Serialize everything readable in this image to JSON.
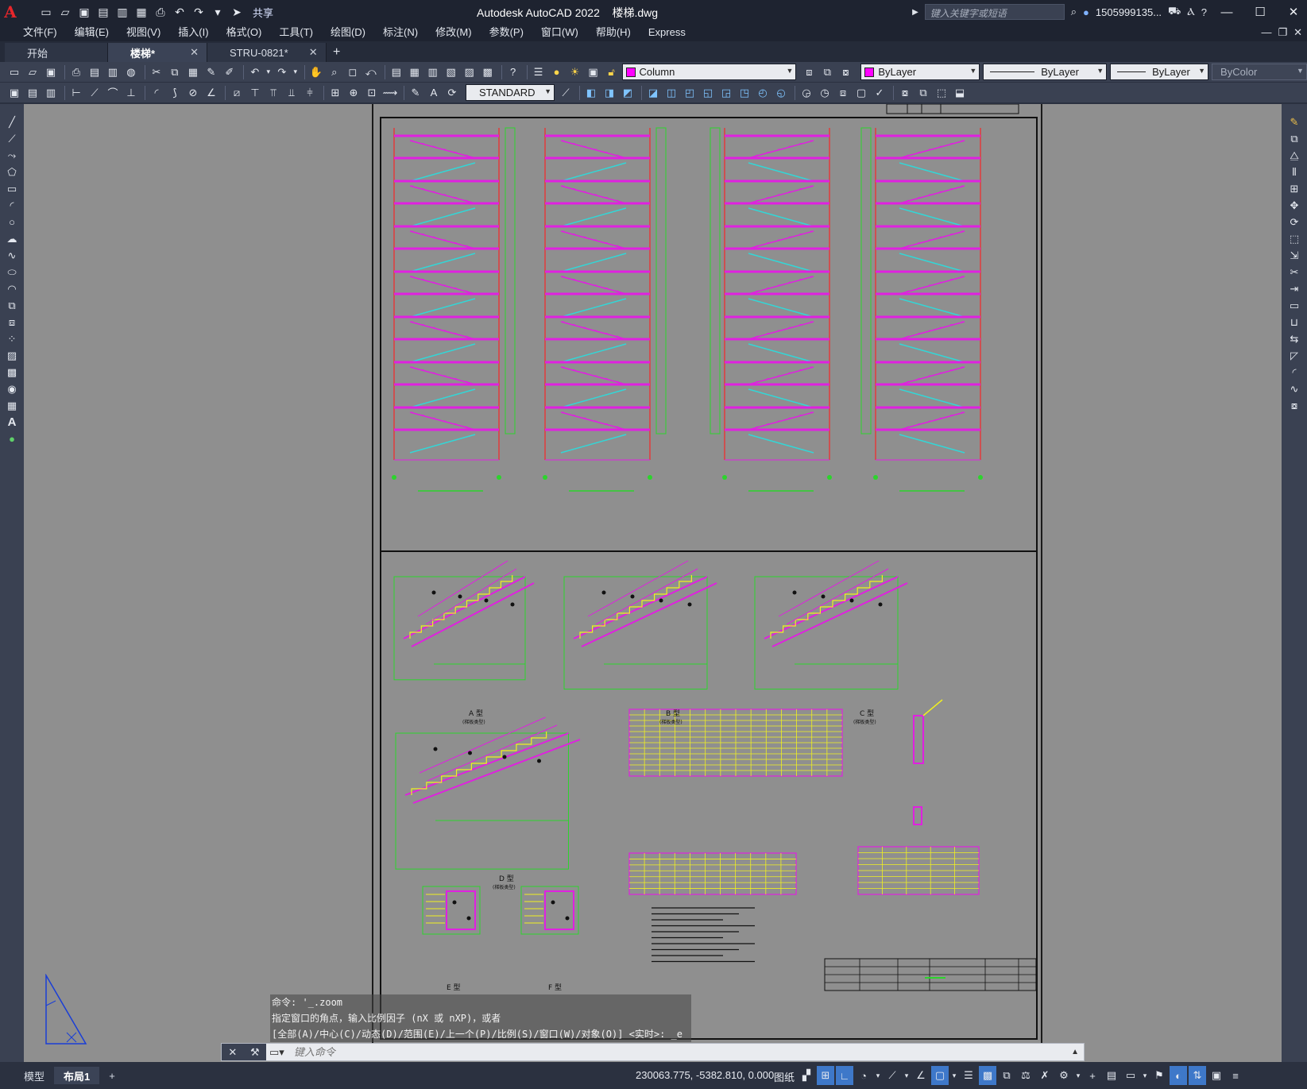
{
  "app": {
    "title": "Autodesk AutoCAD 2022",
    "file": "楼梯.dwg",
    "logo": "A",
    "share_label": "共享",
    "search_placeholder": "键入关键字或短语",
    "user": "1505999135..."
  },
  "menu": [
    "文件(F)",
    "编辑(E)",
    "视图(V)",
    "插入(I)",
    "格式(O)",
    "工具(T)",
    "绘图(D)",
    "标注(N)",
    "修改(M)",
    "参数(P)",
    "窗口(W)",
    "帮助(H)",
    "Express"
  ],
  "tabs": [
    {
      "label": "开始",
      "active": false,
      "closable": false
    },
    {
      "label": "楼梯*",
      "active": true,
      "closable": true
    },
    {
      "label": "STRU-0821*",
      "active": false,
      "closable": true
    }
  ],
  "properties": {
    "layer": "Column",
    "layer_color": "#ff00ff",
    "color": "ByLayer",
    "linetype": "ByLayer",
    "lineweight": "ByLayer",
    "plotstyle": "ByColor",
    "text_style": "STANDARD"
  },
  "command": {
    "history": [
      "命令: '_.zoom",
      "指定窗口的角点，输入比例因子 (nX 或 nXP)，或者",
      "[全部(A)/中心(C)/动态(D)/范围(E)/上一个(P)/比例(S)/窗口(W)/对象(O)] <实时>: _e"
    ],
    "placeholder": "键入命令"
  },
  "drawing": {
    "detail_labels": [
      "A 型",
      "B 型",
      "C 型",
      "D 型",
      "E 型",
      "F 型"
    ],
    "detail_sublabel": "(梯板类型)"
  },
  "status": {
    "layout_tabs": [
      {
        "label": "模型",
        "active": false
      },
      {
        "label": "布局1",
        "active": true
      }
    ],
    "coords": "230063.775, -5382.810, 0.000",
    "space": "图纸"
  }
}
